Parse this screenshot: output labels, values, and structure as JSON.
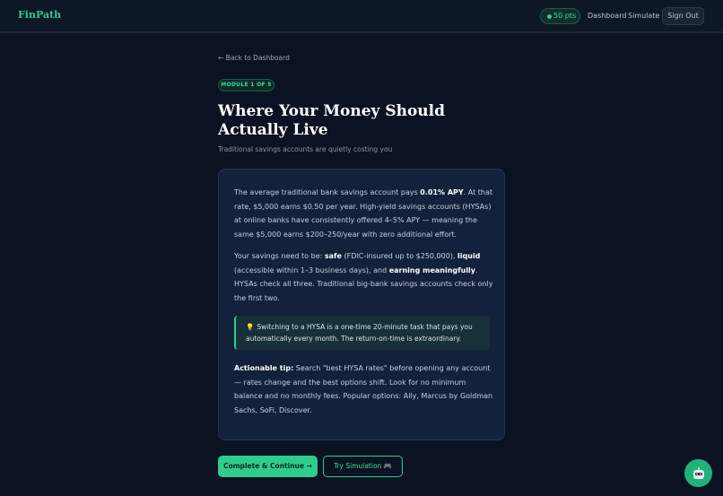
{
  "header": {
    "logo": "FinPath",
    "points": "50 pts",
    "nav": {
      "dashboard": "Dashboard",
      "simulate": "Simulate",
      "signout": "Sign Out"
    }
  },
  "lesson": {
    "back_link": "← Back to Dashboard",
    "module_badge": "MODULE 1 OF 5",
    "title": "Where Your Money Should Actually Live",
    "subtitle": "Traditional savings accounts are quietly costing you",
    "p1": {
      "a": "The average traditional bank savings account pays ",
      "b": "0.01% APY",
      "c": ". At that rate, $5,000 earns $0.50 per year. High-yield savings accounts (HYSAs) at online banks have consistently offered 4–5% APY — meaning the same $5,000 earns $200–250/year with zero additional effort."
    },
    "p2": {
      "a": "Your savings need to be: ",
      "b": "safe",
      "c": " (FDIC-insured up to $250,000), ",
      "d": "liquid",
      "e": " (accessible within 1–3 business days), and ",
      "f": "earning meaningfully",
      "g": ". HYSAs check all three. Traditional big-bank savings accounts check only the first two."
    },
    "callout": {
      "icon": "💡",
      "text": "Switching to a HYSA is a one-time 20-minute task that pays you automatically every month. The return-on-time is extraordinary."
    },
    "p3": {
      "a": "Actionable tip:",
      "b": " Search \"best HYSA rates\" before opening any account — rates change and the best options shift. Look for no minimum balance and no monthly fees. Popular options: Ally, Marcus by Goldman Sachs, SoFi, Discover."
    }
  },
  "actions": {
    "complete": "Complete & Continue →",
    "simulation": "Try Simulation 🎮"
  },
  "chat": {
    "icon": "robot-icon"
  },
  "colors": {
    "accent": "#2ecc8f",
    "background": "#0b1322",
    "card": "#13213a"
  }
}
